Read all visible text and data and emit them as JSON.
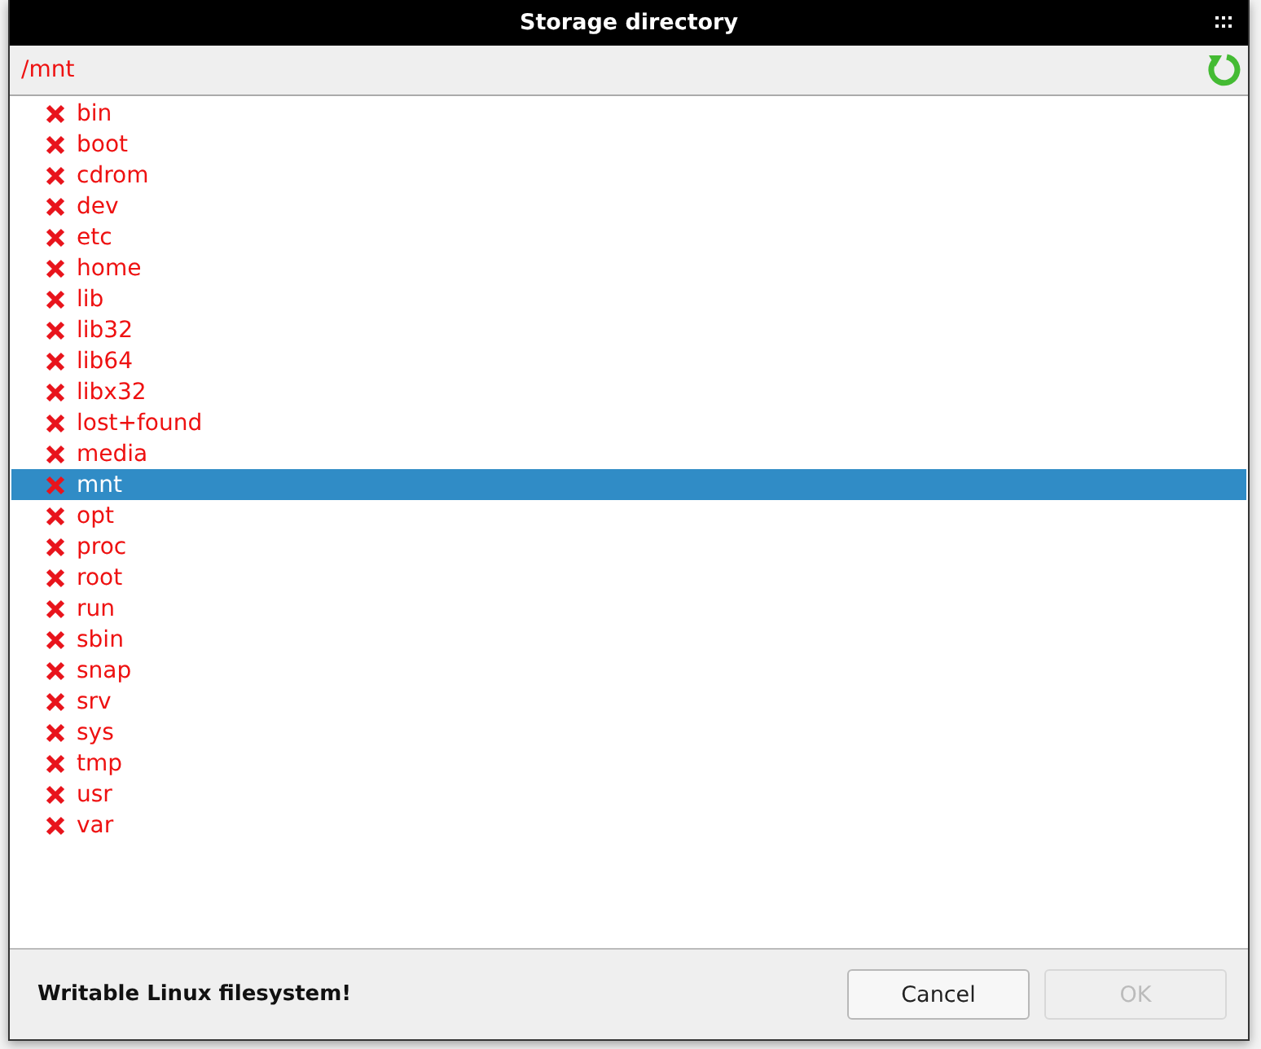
{
  "window": {
    "title": "Storage directory"
  },
  "path": "/mnt",
  "entries": [
    {
      "name": "bin",
      "writable": false,
      "selected": false
    },
    {
      "name": "boot",
      "writable": false,
      "selected": false
    },
    {
      "name": "cdrom",
      "writable": false,
      "selected": false
    },
    {
      "name": "dev",
      "writable": false,
      "selected": false
    },
    {
      "name": "etc",
      "writable": false,
      "selected": false
    },
    {
      "name": "home",
      "writable": false,
      "selected": false
    },
    {
      "name": "lib",
      "writable": false,
      "selected": false
    },
    {
      "name": "lib32",
      "writable": false,
      "selected": false
    },
    {
      "name": "lib64",
      "writable": false,
      "selected": false
    },
    {
      "name": "libx32",
      "writable": false,
      "selected": false
    },
    {
      "name": "lost+found",
      "writable": false,
      "selected": false
    },
    {
      "name": "media",
      "writable": false,
      "selected": false
    },
    {
      "name": "mnt",
      "writable": false,
      "selected": true
    },
    {
      "name": "opt",
      "writable": false,
      "selected": false
    },
    {
      "name": "proc",
      "writable": false,
      "selected": false
    },
    {
      "name": "root",
      "writable": false,
      "selected": false
    },
    {
      "name": "run",
      "writable": false,
      "selected": false
    },
    {
      "name": "sbin",
      "writable": false,
      "selected": false
    },
    {
      "name": "snap",
      "writable": false,
      "selected": false
    },
    {
      "name": "srv",
      "writable": false,
      "selected": false
    },
    {
      "name": "sys",
      "writable": false,
      "selected": false
    },
    {
      "name": "tmp",
      "writable": false,
      "selected": false
    },
    {
      "name": "usr",
      "writable": false,
      "selected": false
    },
    {
      "name": "var",
      "writable": false,
      "selected": false
    }
  ],
  "status": "Writable Linux filesystem!",
  "buttons": [
    {
      "label": "Cancel",
      "disabled": false
    },
    {
      "label": "OK",
      "disabled": true
    }
  ]
}
